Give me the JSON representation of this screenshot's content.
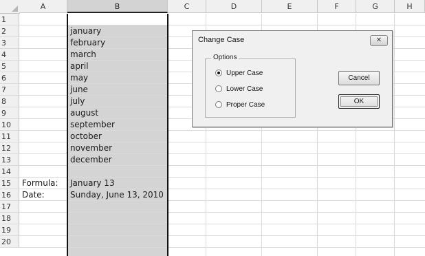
{
  "columns": [
    "A",
    "B",
    "C",
    "D",
    "E",
    "F",
    "G",
    "H"
  ],
  "rows": [
    "1",
    "2",
    "3",
    "4",
    "5",
    "6",
    "7",
    "8",
    "9",
    "10",
    "11",
    "12",
    "13",
    "14",
    "15",
    "16",
    "17",
    "18",
    "19",
    "20"
  ],
  "cells": {
    "B2": "january",
    "B3": "february",
    "B4": "march",
    "B5": "april",
    "B6": "may",
    "B7": "june",
    "B8": "july",
    "B9": "august",
    "B10": "september",
    "B11": "october",
    "B12": "november",
    "B13": "december",
    "A15": "Formula:",
    "B15": "January 13",
    "A16": "Date:",
    "B16": "Sunday, June 13, 2010"
  },
  "dialog": {
    "title": "Change Case",
    "close_glyph": "✕",
    "group_label": "Options",
    "options": [
      {
        "label": "Upper Case",
        "selected": true
      },
      {
        "label": "Lower Case",
        "selected": false
      },
      {
        "label": "Proper Case",
        "selected": false
      }
    ],
    "cancel_label": "Cancel",
    "ok_label": "OK"
  },
  "colors": {
    "selection_fill": "#d4d4d4",
    "selection_border": "#111111",
    "dialog_bg": "#f0f0f0"
  }
}
